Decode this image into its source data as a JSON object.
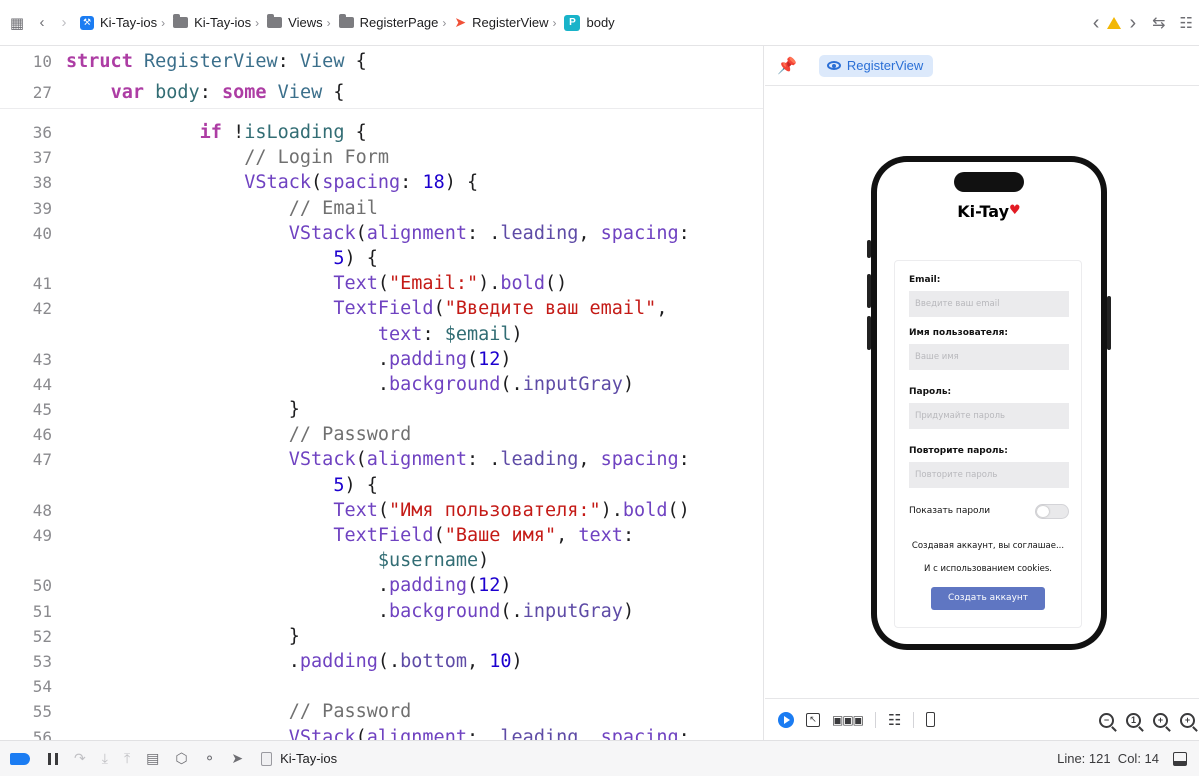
{
  "breadcrumb": {
    "items": [
      {
        "label": "Ki-Tay-ios",
        "icon": "xcode-project-icon"
      },
      {
        "label": "Ki-Tay-ios",
        "icon": "folder-icon"
      },
      {
        "label": "Views",
        "icon": "folder-icon"
      },
      {
        "label": "RegisterPage",
        "icon": "folder-icon"
      },
      {
        "label": "RegisterView",
        "icon": "swift-file-icon"
      },
      {
        "label": "body",
        "icon": "property-icon",
        "icon_glyph": "P"
      }
    ]
  },
  "editor": {
    "sticky": [
      {
        "ln": "10",
        "tokens": [
          {
            "t": "struct",
            "c": "kw"
          },
          {
            "t": " "
          },
          {
            "t": "RegisterView",
            "c": "ty"
          },
          {
            "t": ": "
          },
          {
            "t": "View",
            "c": "ty"
          },
          {
            "t": " {"
          }
        ]
      },
      {
        "ln": "27",
        "tokens": [
          {
            "t": "    "
          },
          {
            "t": "var",
            "c": "kw"
          },
          {
            "t": " "
          },
          {
            "t": "body",
            "c": "prop"
          },
          {
            "t": ": "
          },
          {
            "t": "some",
            "c": "kw"
          },
          {
            "t": " "
          },
          {
            "t": "View",
            "c": "ty"
          },
          {
            "t": " {"
          }
        ]
      }
    ],
    "lines": [
      {
        "ln": "36",
        "tokens": [
          {
            "t": "            "
          },
          {
            "t": "if",
            "c": "kw"
          },
          {
            "t": " !"
          },
          {
            "t": "isLoading",
            "c": "prop"
          },
          {
            "t": " {"
          }
        ]
      },
      {
        "ln": "37",
        "tokens": [
          {
            "t": "                "
          },
          {
            "t": "// Login Form",
            "c": "cm"
          }
        ]
      },
      {
        "ln": "38",
        "tokens": [
          {
            "t": "                "
          },
          {
            "t": "VStack",
            "c": "fn"
          },
          {
            "t": "("
          },
          {
            "t": "spacing",
            "c": "fn"
          },
          {
            "t": ": "
          },
          {
            "t": "18",
            "c": "num"
          },
          {
            "t": ") {"
          }
        ]
      },
      {
        "ln": "39",
        "tokens": [
          {
            "t": "                    "
          },
          {
            "t": "// Email",
            "c": "cm"
          }
        ]
      },
      {
        "ln": "40",
        "tokens": [
          {
            "t": "                    "
          },
          {
            "t": "VStack",
            "c": "fn"
          },
          {
            "t": "("
          },
          {
            "t": "alignment",
            "c": "fn"
          },
          {
            "t": ": ."
          },
          {
            "t": "leading",
            "c": "member"
          },
          {
            "t": ", "
          },
          {
            "t": "spacing",
            "c": "fn"
          },
          {
            "t": ":"
          }
        ]
      },
      {
        "ln": "",
        "tokens": [
          {
            "t": "                        "
          },
          {
            "t": "5",
            "c": "num"
          },
          {
            "t": ") {"
          }
        ]
      },
      {
        "ln": "41",
        "tokens": [
          {
            "t": "                        "
          },
          {
            "t": "Text",
            "c": "fn"
          },
          {
            "t": "("
          },
          {
            "t": "\"Email:\"",
            "c": "str"
          },
          {
            "t": ")."
          },
          {
            "t": "bold",
            "c": "fn"
          },
          {
            "t": "()"
          }
        ]
      },
      {
        "ln": "42",
        "tokens": [
          {
            "t": "                        "
          },
          {
            "t": "TextField",
            "c": "fn"
          },
          {
            "t": "("
          },
          {
            "t": "\"Введите ваш email\"",
            "c": "str"
          },
          {
            "t": ","
          }
        ]
      },
      {
        "ln": "",
        "tokens": [
          {
            "t": "                            "
          },
          {
            "t": "text",
            "c": "fn"
          },
          {
            "t": ": "
          },
          {
            "t": "$email",
            "c": "prop"
          },
          {
            "t": ")"
          }
        ]
      },
      {
        "ln": "43",
        "tokens": [
          {
            "t": "                            ."
          },
          {
            "t": "padding",
            "c": "fn"
          },
          {
            "t": "("
          },
          {
            "t": "12",
            "c": "num"
          },
          {
            "t": ")"
          }
        ]
      },
      {
        "ln": "44",
        "tokens": [
          {
            "t": "                            ."
          },
          {
            "t": "background",
            "c": "fn"
          },
          {
            "t": "(."
          },
          {
            "t": "inputGray",
            "c": "member"
          },
          {
            "t": ")"
          }
        ]
      },
      {
        "ln": "45",
        "tokens": [
          {
            "t": "                    }"
          }
        ]
      },
      {
        "ln": "46",
        "tokens": [
          {
            "t": "                    "
          },
          {
            "t": "// Password",
            "c": "cm"
          }
        ]
      },
      {
        "ln": "47",
        "tokens": [
          {
            "t": "                    "
          },
          {
            "t": "VStack",
            "c": "fn"
          },
          {
            "t": "("
          },
          {
            "t": "alignment",
            "c": "fn"
          },
          {
            "t": ": ."
          },
          {
            "t": "leading",
            "c": "member"
          },
          {
            "t": ", "
          },
          {
            "t": "spacing",
            "c": "fn"
          },
          {
            "t": ":"
          }
        ]
      },
      {
        "ln": "",
        "tokens": [
          {
            "t": "                        "
          },
          {
            "t": "5",
            "c": "num"
          },
          {
            "t": ") {"
          }
        ]
      },
      {
        "ln": "48",
        "tokens": [
          {
            "t": "                        "
          },
          {
            "t": "Text",
            "c": "fn"
          },
          {
            "t": "("
          },
          {
            "t": "\"Имя пользователя:\"",
            "c": "str"
          },
          {
            "t": ")."
          },
          {
            "t": "bold",
            "c": "fn"
          },
          {
            "t": "()"
          }
        ]
      },
      {
        "ln": "49",
        "tokens": [
          {
            "t": "                        "
          },
          {
            "t": "TextField",
            "c": "fn"
          },
          {
            "t": "("
          },
          {
            "t": "\"Ваше имя\"",
            "c": "str"
          },
          {
            "t": ", "
          },
          {
            "t": "text",
            "c": "fn"
          },
          {
            "t": ":"
          }
        ]
      },
      {
        "ln": "",
        "tokens": [
          {
            "t": "                            "
          },
          {
            "t": "$username",
            "c": "prop"
          },
          {
            "t": ")"
          }
        ]
      },
      {
        "ln": "50",
        "tokens": [
          {
            "t": "                            ."
          },
          {
            "t": "padding",
            "c": "fn"
          },
          {
            "t": "("
          },
          {
            "t": "12",
            "c": "num"
          },
          {
            "t": ")"
          }
        ]
      },
      {
        "ln": "51",
        "tokens": [
          {
            "t": "                            ."
          },
          {
            "t": "background",
            "c": "fn"
          },
          {
            "t": "(."
          },
          {
            "t": "inputGray",
            "c": "member"
          },
          {
            "t": ")"
          }
        ]
      },
      {
        "ln": "52",
        "tokens": [
          {
            "t": "                    }"
          }
        ]
      },
      {
        "ln": "53",
        "tokens": [
          {
            "t": "                    ."
          },
          {
            "t": "padding",
            "c": "fn"
          },
          {
            "t": "(."
          },
          {
            "t": "bottom",
            "c": "member"
          },
          {
            "t": ", "
          },
          {
            "t": "10",
            "c": "num"
          },
          {
            "t": ")"
          }
        ]
      },
      {
        "ln": "54",
        "tokens": [
          {
            "t": ""
          }
        ]
      },
      {
        "ln": "55",
        "tokens": [
          {
            "t": "                    "
          },
          {
            "t": "// Password",
            "c": "cm"
          }
        ]
      },
      {
        "ln": "56",
        "tokens": [
          {
            "t": "                    "
          },
          {
            "t": "VStack",
            "c": "fn"
          },
          {
            "t": "("
          },
          {
            "t": "alignment",
            "c": "fn"
          },
          {
            "t": ": ."
          },
          {
            "t": "leading",
            "c": "member"
          },
          {
            "t": ", "
          },
          {
            "t": "spacing",
            "c": "fn"
          },
          {
            "t": ":"
          }
        ]
      }
    ]
  },
  "preview": {
    "chip_label": "RegisterView",
    "app": {
      "brand": "Ki-Tay",
      "brand_heart": "♥",
      "fields": [
        {
          "label": "Email:",
          "placeholder": "Введите ваш email"
        },
        {
          "label": "Имя пользователя:",
          "placeholder": "Ваше имя"
        },
        {
          "label": "Пароль:",
          "placeholder": "Придумайте пароль"
        },
        {
          "label": "Повторите пароль:",
          "placeholder": "Повторите пароль"
        }
      ],
      "show_passwords_label": "Показать пароли",
      "show_passwords_on": false,
      "terms_line1": "Создавая аккаунт, вы соглашае...",
      "terms_line2": "И с использованием cookies.",
      "cta_label": "Создать аккаунт",
      "cta_color": "#5f76c2"
    }
  },
  "debugbar": {
    "target": "Ki-Tay-ios",
    "status": "Line: 121  Col: 14"
  },
  "colors": {
    "accent": "#1b7cf2",
    "warning": "#f2b705",
    "keyword": "#ad3da4",
    "string": "#c41a16"
  }
}
